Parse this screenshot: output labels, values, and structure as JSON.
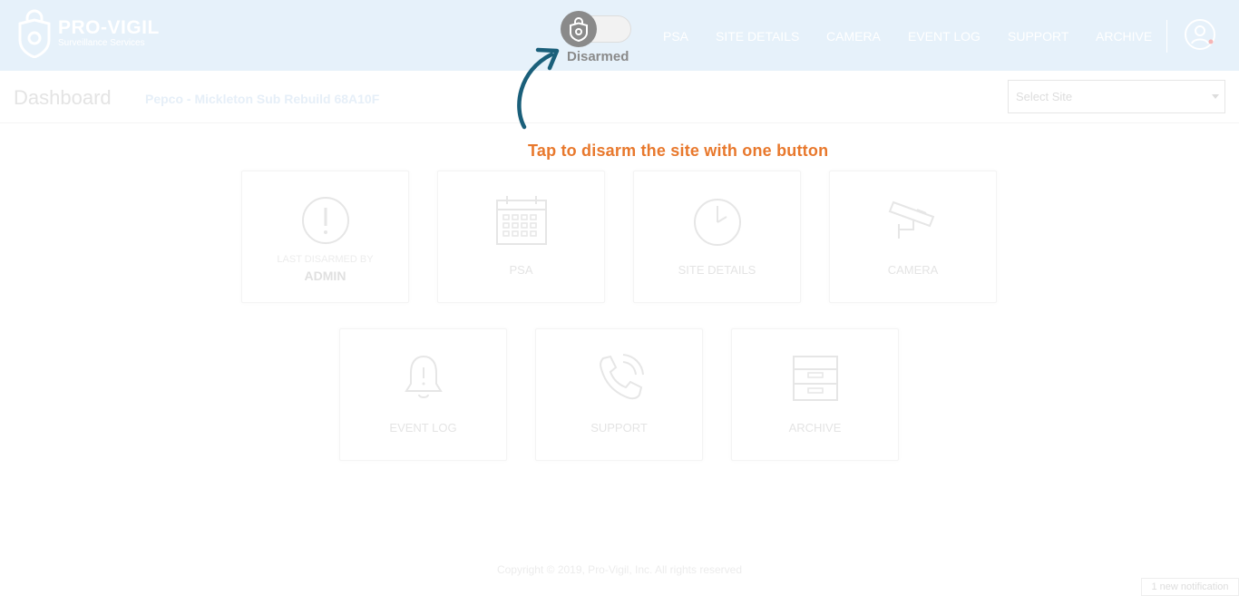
{
  "brand": {
    "title": "PRO-VIGIL",
    "subtitle": "Surveillance Services"
  },
  "nav": {
    "items": [
      "PSA",
      "SITE DETAILS",
      "CAMERA",
      "EVENT LOG",
      "SUPPORT",
      "ARCHIVE"
    ]
  },
  "toggle": {
    "state_label": "Disarmed",
    "armed": false
  },
  "page": {
    "title": "Dashboard",
    "site_name": "Pepco - Mickleton Sub Rebuild 68A10F"
  },
  "site_select": {
    "placeholder": "Select Site"
  },
  "hint": {
    "text": "Tap to disarm the site with one button"
  },
  "tiles": {
    "last_disarmed": {
      "caption": "LAST DISARMED BY",
      "value": "ADMIN",
      "icon": "exclamation-circle-icon"
    },
    "psa": {
      "label": "PSA",
      "icon": "calendar-icon"
    },
    "site_details": {
      "label": "SITE DETAILS",
      "icon": "clock-icon"
    },
    "camera": {
      "label": "CAMERA",
      "icon": "security-camera-icon"
    },
    "event_log": {
      "label": "EVENT LOG",
      "icon": "bell-icon"
    },
    "support": {
      "label": "SUPPORT",
      "icon": "phone-icon"
    },
    "archive": {
      "label": "ARCHIVE",
      "icon": "archive-box-icon"
    }
  },
  "footer": {
    "copyright": "Copyright © 2019, Pro-Vigil, Inc. All rights reserved"
  },
  "notification": {
    "text": "1 new notification"
  },
  "colors": {
    "header_bg": "#e6f1fa",
    "hint": "#e8782c",
    "arrow": "#1a5f7a",
    "toggle_knob": "#8a8a8a"
  }
}
